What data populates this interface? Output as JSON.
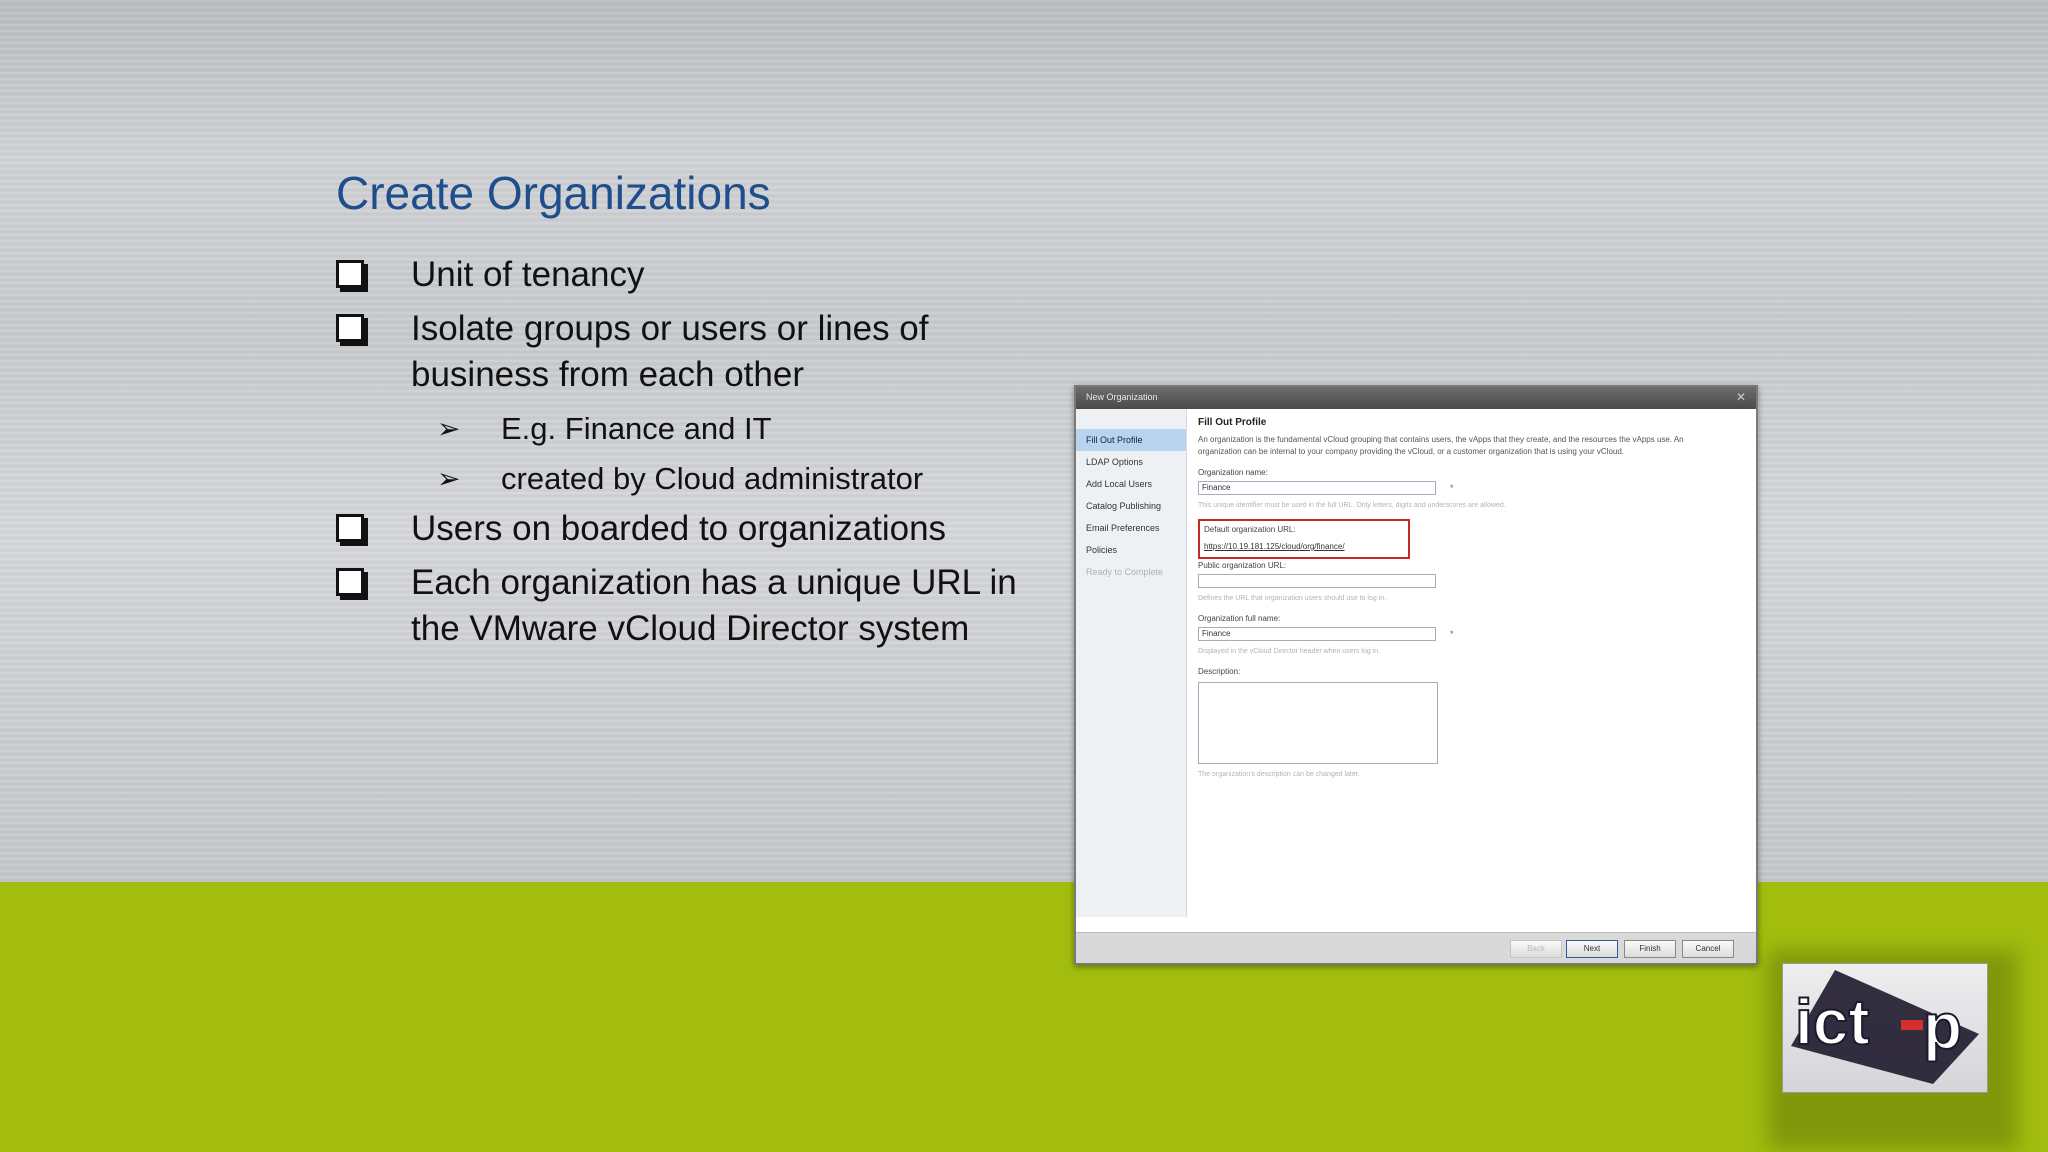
{
  "slide": {
    "title": "Create Organizations",
    "bullets": [
      {
        "text": "Unit of tenancy"
      },
      {
        "text": "Isolate groups or users or lines of business from each other",
        "sub": [
          "E.g. Finance and IT",
          "created by Cloud administrator"
        ]
      },
      {
        "text": "Users on boarded to organizations"
      },
      {
        "text": "Each organization has a unique URL in the VMware vCloud Director system"
      }
    ]
  },
  "screenshot": {
    "window_title": "New Organization",
    "nav_items": [
      "Fill Out Profile",
      "LDAP Options",
      "Add Local Users",
      "Catalog Publishing",
      "Email Preferences",
      "Policies",
      "Ready to Complete"
    ],
    "heading": "Fill Out Profile",
    "description": "An organization is the fundamental vCloud grouping that contains users, the vApps that they create, and the resources the vApps use. An organization can be internal to your company providing the vCloud, or a customer organization that is using your vCloud.",
    "org_name_label": "Organization name:",
    "org_name_value": "Finance",
    "org_name_help": "This unique identifier must be used in the full URL. Only letters, digits and underscores are allowed.",
    "default_url_label": "Default organization URL:",
    "default_url_value": "https://10.19.181.125/cloud/org/finance/",
    "public_url_label": "Public organization URL:",
    "public_url_help": "Defines the URL that organization users should use to log in.",
    "full_name_label": "Organization full name:",
    "full_name_value": "Finance",
    "full_name_help": "Displayed in the vCloud Director header when users log in.",
    "description_label": "Description:",
    "description_help": "The organization's description can be changed later.",
    "buttons": {
      "back": "Back",
      "next": "Next",
      "finish": "Finish",
      "cancel": "Cancel"
    }
  },
  "logo": {
    "text": "ict-p",
    "colors": {
      "dark": "#1e1a2e",
      "accent": "#d32f2f"
    }
  },
  "colors": {
    "title": "#1f4e8c",
    "green_band": "#a2bd0e"
  }
}
